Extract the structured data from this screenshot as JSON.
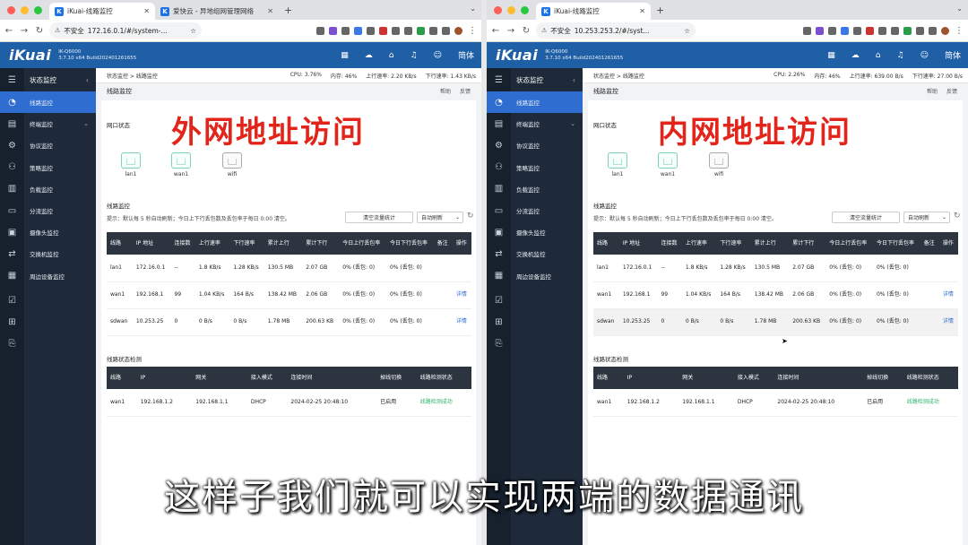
{
  "left": {
    "tabs": [
      {
        "title": "iKuai-线路监控",
        "active": true
      },
      {
        "title": "爱快云 - 异地组网管理网络",
        "active": false
      }
    ],
    "url": "172.16.0.1/#/system-...",
    "insecure_label": "不安全",
    "overlay_title": "外网地址访问"
  },
  "right": {
    "tabs": [
      {
        "title": "iKuai-线路监控",
        "active": true
      }
    ],
    "url": "10.253.253.2/#/syst...",
    "insecure_label": "不安全",
    "overlay_title": "内网地址访问"
  },
  "app": {
    "logo": "iKuai",
    "model_line1": "IK-Q6000",
    "model_line2": "3.7.10 x64 Build202401261655",
    "lang": "简体"
  },
  "sidebar": {
    "header": "状态监控",
    "items": [
      "线路监控",
      "终端监控",
      "协议监控",
      "策略监控",
      "负载监控",
      "分流监控",
      "摄像头监控",
      "交换机监控",
      "周边设备监控"
    ]
  },
  "breadcrumb": "状态监控 > 线路监控",
  "stats_left": {
    "cpu": "CPU: 3.76%",
    "mem": "内存: 46%",
    "up": "上行速率: 2.20 KB/s",
    "down": "下行速率: 1.43 KB/s"
  },
  "stats_right": {
    "cpu": "CPU: 2.26%",
    "mem": "内存: 46%",
    "up": "上行速率: 639.00 B/s",
    "down": "下行速率: 27.00 B/s"
  },
  "page": {
    "title": "线路监控",
    "help": "帮助",
    "feedback": "反馈",
    "port_section": "网口状态",
    "ports": [
      "lan1",
      "wan1",
      "wifi"
    ],
    "line_section": "线路监控",
    "hint": "提示：默认每 5 秒自动刷新；今日上下行丢包数及丢包率于每日 0:00 清空。",
    "clear_btn": "清空流量统计",
    "auto_refresh": "自动刷新",
    "line_headers": [
      "线路",
      "IP 地址",
      "连接数",
      "上行速率",
      "下行速率",
      "累计上行",
      "累计下行",
      "今日上行丢包率",
      "今日下行丢包率",
      "备注",
      "操作"
    ],
    "status_section": "线路状态检测",
    "status_headers": [
      "线路",
      "IP",
      "网关",
      "接入模式",
      "连接时间",
      "掉线切换",
      "线路检测状态"
    ],
    "status_rows": [
      [
        "wan1",
        "192.168.1.2",
        "192.168.1.1",
        "DHCP",
        "2024-02-25 20:48:10",
        "已启用",
        "线路检测成功"
      ]
    ]
  },
  "rows_left": [
    [
      "lan1",
      "172.16.0.1",
      "--",
      "1.8 KB/s",
      "1.28 KB/s",
      "130.5 MB",
      "2.07 GB",
      "0% (丢包: 0)",
      "0% (丢包: 0)",
      "",
      ""
    ],
    [
      "wan1",
      "192.168.1",
      "99",
      "1.04 KB/s",
      "164 B/s",
      "138.42 MB",
      "2.06 GB",
      "0% (丢包: 0)",
      "0% (丢包: 0)",
      "",
      "详情"
    ],
    [
      "sdwan",
      "10.253.25",
      "0",
      "0 B/s",
      "0 B/s",
      "1.78 MB",
      "200.63 KB",
      "0% (丢包: 0)",
      "0% (丢包: 0)",
      "",
      "详情"
    ]
  ],
  "rows_right": [
    [
      "lan1",
      "172.16.0.1",
      "--",
      "1.8 KB/s",
      "1.28 KB/s",
      "130.5 MB",
      "2.07 GB",
      "0% (丢包: 0)",
      "0% (丢包: 0)",
      "",
      ""
    ],
    [
      "wan1",
      "192.168.1",
      "99",
      "1.04 KB/s",
      "164 B/s",
      "138.42 MB",
      "2.06 GB",
      "0% (丢包: 0)",
      "0% (丢包: 0)",
      "",
      "详情"
    ],
    [
      "sdwan",
      "10.253.25",
      "0",
      "0 B/s",
      "0 B/s",
      "1.78 MB",
      "200.63 KB",
      "0% (丢包: 0)",
      "0% (丢包: 0)",
      "",
      "详情"
    ]
  ],
  "subtitle": "这样子我们就可以实现两端的数据通讯",
  "colors": {
    "appbar": "#1f5fa6",
    "sidebar": "#1e2a3a",
    "active": "#2f6dd0",
    "overlay_red": "#e3241b",
    "ok_green": "#33b36b"
  }
}
